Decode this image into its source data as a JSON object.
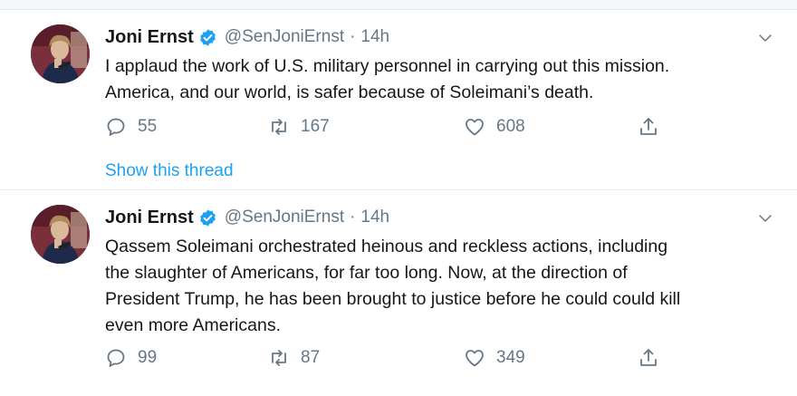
{
  "tweets": [
    {
      "name": "Joni Ernst",
      "handle": "@SenJoniErnst",
      "separator": "·",
      "time": "14h",
      "text_lines": [
        "I applaud the work of U.S. military personnel in carrying out this mission.",
        "America, and our world, is safer because of Soleimani’s death."
      ],
      "replies": "55",
      "retweets": "167",
      "likes": "608",
      "thread_link": "Show this thread"
    },
    {
      "name": "Joni Ernst",
      "handle": "@SenJoniErnst",
      "separator": "·",
      "time": "14h",
      "text_lines": [
        "Qassem Soleimani orchestrated heinous and reckless actions, including",
        "the slaughter of Americans, for far too long. Now, at the direction of",
        "President Trump, he has been brought to justice before he could could kill",
        "even more Americans."
      ],
      "replies": "99",
      "retweets": "87",
      "likes": "349"
    }
  ],
  "colors": {
    "link": "#1da1f2",
    "secondary_text": "#657786",
    "primary_text": "#14171a",
    "verified_badge": "#1da1f2",
    "divider": "#e6ecf0"
  },
  "icons": {
    "verified": "verified-badge-icon",
    "caret": "chevron-down-icon",
    "reply": "reply-bubble-icon",
    "retweet": "retweet-icon",
    "like": "heart-icon",
    "share": "share-icon"
  }
}
